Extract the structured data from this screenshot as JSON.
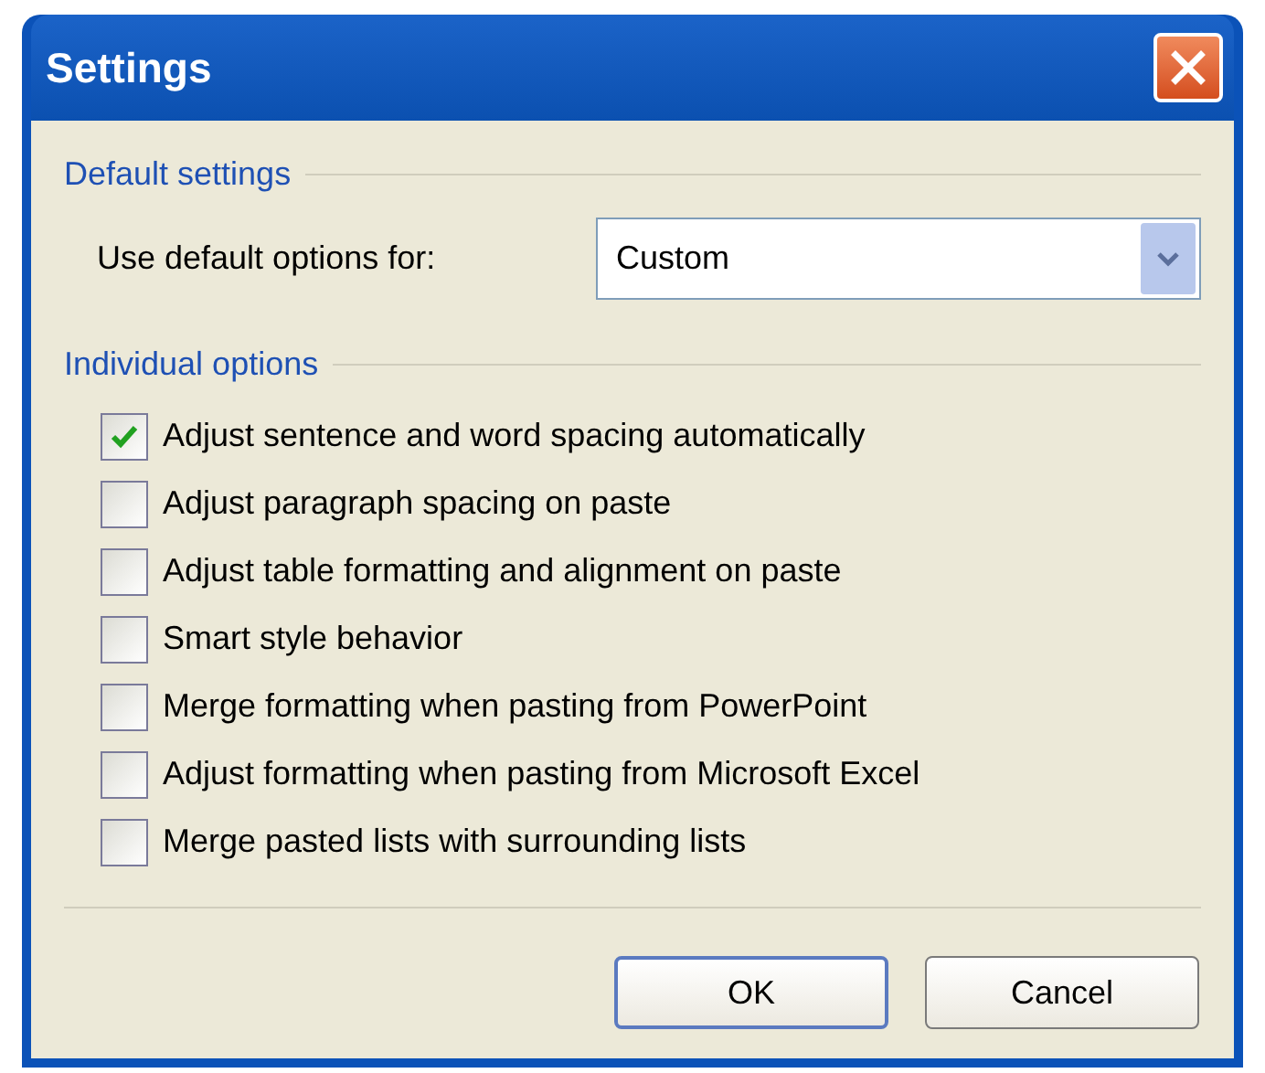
{
  "window": {
    "title": "Settings"
  },
  "default_settings": {
    "heading": "Default settings",
    "label": "Use default options for:",
    "value": "Custom"
  },
  "individual_options": {
    "heading": "Individual options",
    "items": [
      {
        "label": "Adjust sentence and word spacing automatically",
        "checked": true
      },
      {
        "label": "Adjust paragraph spacing on paste",
        "checked": false
      },
      {
        "label": "Adjust table formatting and alignment on paste",
        "checked": false
      },
      {
        "label": "Smart style behavior",
        "checked": false
      },
      {
        "label": "Merge formatting when pasting from PowerPoint",
        "checked": false
      },
      {
        "label": "Adjust formatting when pasting from Microsoft Excel",
        "checked": false
      },
      {
        "label": "Merge pasted lists with surrounding lists",
        "checked": false
      }
    ]
  },
  "buttons": [
    {
      "label": "OK",
      "default": true
    },
    {
      "label": "Cancel",
      "default": false
    }
  ]
}
